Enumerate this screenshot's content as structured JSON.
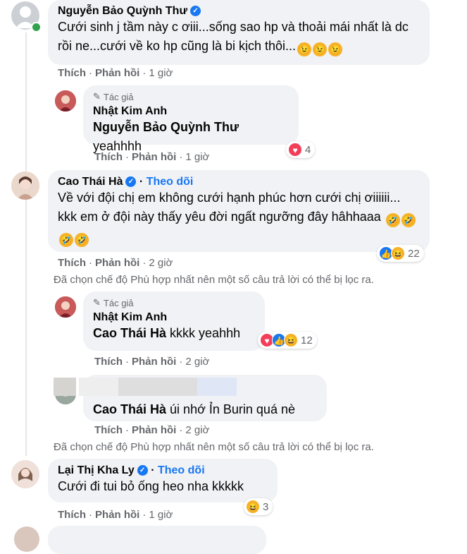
{
  "comments": [
    {
      "name": "Nguyễn Bảo Quỳnh Thư",
      "text": "Cưới sinh j tầm này c ơiii...sống sao hp và thoải mái nhất là dc rồi ne...cưới về ko hp cũng là bi kịch thôi...",
      "emojis": [
        "wink-emoji",
        "wink-emoji",
        "wink-emoji"
      ],
      "actions": {
        "like": "Thích",
        "reply": "Phản hồi",
        "time": "1 giờ"
      }
    },
    {
      "author_badge": "Tác giả",
      "name": "Nhật Kim Anh",
      "tag": "Nguyễn Bảo Quỳnh Thư",
      "text": "yeahhhh",
      "reaction_count": "4",
      "actions": {
        "like": "Thích",
        "reply": "Phản hồi",
        "time": "1 giờ"
      }
    },
    {
      "name": "Cao Thái Hà",
      "follow": "Theo dõi",
      "text": "Về với đội chị em không cưới hạnh phúc hơn cưới chị ơiiiiii... kkk em ở đội này thấy yêu đời ngất ngưỡng đây hâhhaaa",
      "emojis": [
        "rofl-emoji",
        "rofl-emoji",
        "rofl-emoji",
        "rofl-emoji"
      ],
      "reaction_count": "22",
      "actions": {
        "like": "Thích",
        "reply": "Phản hồi",
        "time": "2 giờ"
      }
    },
    {
      "author_badge": "Tác giả",
      "name": "Nhật Kim Anh",
      "tag": "Cao Thái Hà",
      "text": "kkkk yeahhh",
      "reaction_count": "12",
      "actions": {
        "like": "Thích",
        "reply": "Phản hồi",
        "time": "2 giờ"
      }
    },
    {
      "tag": "Cao Thái Hà",
      "text": "úi nhớ Ỉn Burin quá nè",
      "actions": {
        "like": "Thích",
        "reply": "Phản hồi",
        "time": "2 giờ"
      }
    },
    {
      "name": "Lại Thị Kha Ly",
      "follow": "Theo dõi",
      "text": "Cưới đi tui bỏ ống heo nha kkkkk",
      "reaction_count": "3",
      "actions": {
        "like": "Thích",
        "reply": "Phản hồi",
        "time": "1 giờ"
      }
    }
  ],
  "filter_note": "Đã chọn chế độ Phù hợp nhất nên một số câu trả lời có thể bị lọc ra.",
  "colors": {
    "bubble": "#f0f2f5",
    "link": "#1877f2",
    "meta": "#65676b",
    "heart": "#f33e58",
    "haha": "#f7b125"
  }
}
